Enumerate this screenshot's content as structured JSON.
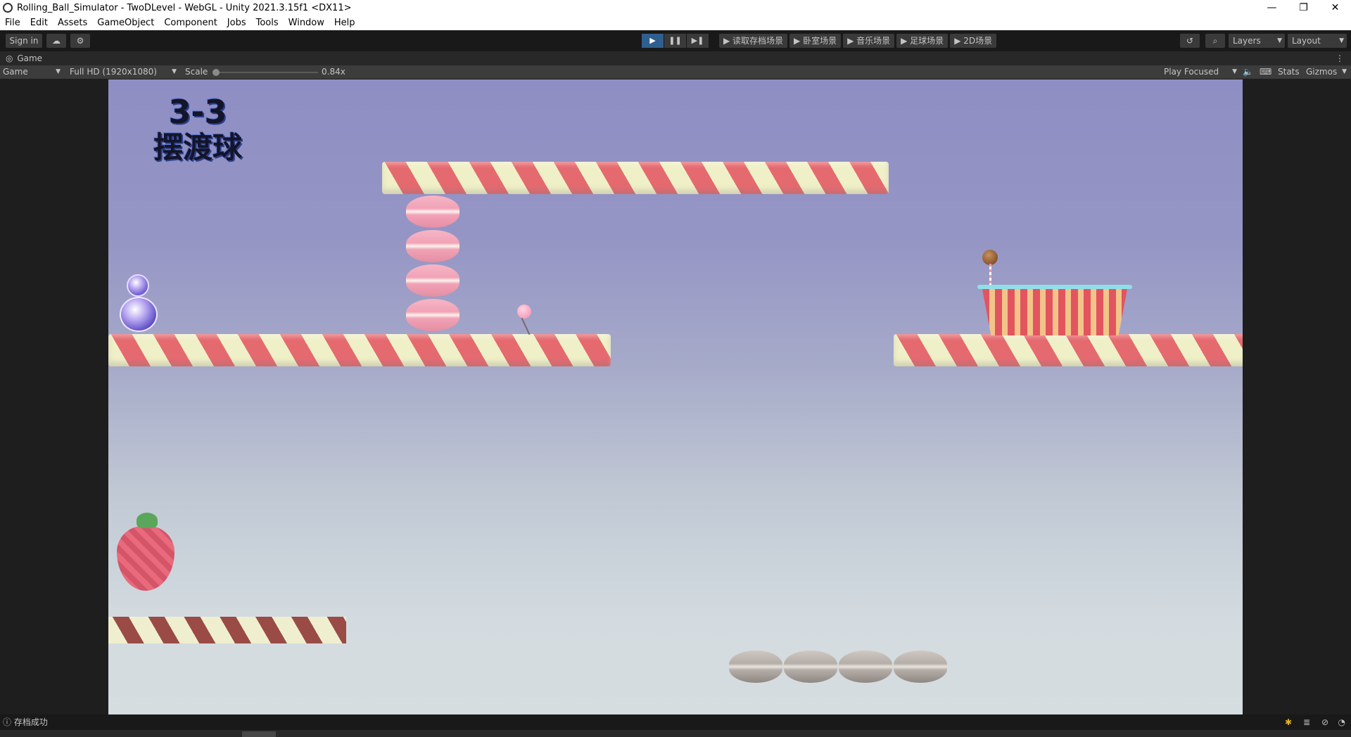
{
  "window": {
    "title": "Rolling_Ball_Simulator - TwoDLevel - WebGL - Unity 2021.3.15f1 <DX11>",
    "controls": [
      "—",
      "❐",
      "✕"
    ]
  },
  "menu": [
    "File",
    "Edit",
    "Assets",
    "GameObject",
    "Component",
    "Jobs",
    "Tools",
    "Window",
    "Help"
  ],
  "toolbar": {
    "sign_in": "Sign in",
    "play_buttons": [
      "▶",
      "❚❚",
      "▶❚"
    ],
    "scene_buttons": [
      "▶ 读取存档场景",
      "▶ 卧室场景",
      "▶ 音乐场景",
      "▶ 足球场景",
      "▶ 2D场景"
    ],
    "layers": "Layers",
    "layout": "Layout"
  },
  "tab": {
    "label": "Game"
  },
  "gamebar": {
    "display": "Game",
    "resolution": "Full HD (1920x1080)",
    "scale_label": "Scale",
    "scale_value": "0.84x",
    "play_mode": "Play Focused",
    "stats": "Stats",
    "gizmos": "Gizmos"
  },
  "game": {
    "level_number": "3-3",
    "level_name": "摆渡球"
  },
  "status": {
    "message": "存档成功"
  },
  "colors": {
    "active_play": "#2f5f8f",
    "stripe_red": "#e56a70",
    "stripe_cream": "#f0f0c8"
  }
}
